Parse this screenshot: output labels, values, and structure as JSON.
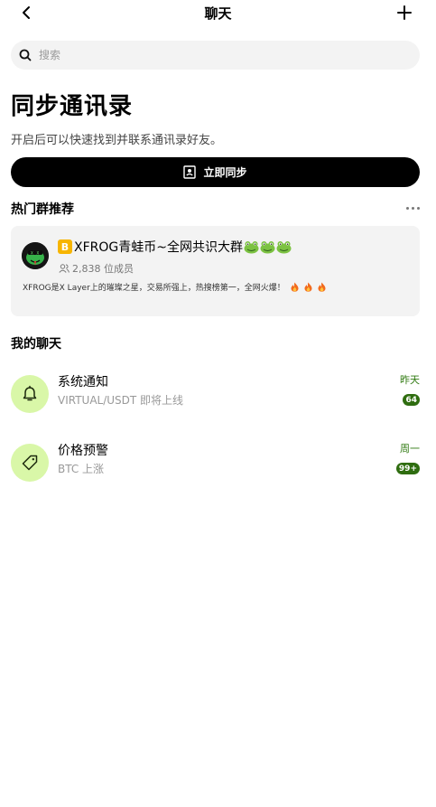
{
  "header": {
    "title": "聊天",
    "back_icon": "chevron-left-icon",
    "add_icon": "plus-icon"
  },
  "search": {
    "placeholder": "搜索",
    "icon": "search-icon"
  },
  "sync": {
    "title": "同步通讯录",
    "description": "开启后可以快速找到并联系通讯录好友。",
    "button_label": "立即同步",
    "button_icon": "contact-book-icon"
  },
  "hot_groups": {
    "title": "热门群推荐",
    "more_icon": "more-dots-icon",
    "group": {
      "badge": "B",
      "name": "XFROG青蛙币~全网共识大群",
      "members": "2,838 位成员",
      "description": "XFROG是X Layer上的璀璨之星，交易所强上，热搜榜第一，全网火爆！"
    }
  },
  "my_chats": {
    "title": "我的聊天",
    "items": [
      {
        "title": "系统通知",
        "subtitle": "VIRTUAL/USDT 即将上线",
        "time": "昨天",
        "badge": "64",
        "icon": "bell-icon"
      },
      {
        "title": "价格预警",
        "subtitle": "BTC 上涨",
        "time": "周一",
        "badge": "99+",
        "icon": "price-tag-icon"
      }
    ]
  },
  "colors": {
    "accent_green": "#2f7a10",
    "avatar_bg": "#d9f7a8",
    "card_bg": "#f3f3f3",
    "button_bg": "#000000"
  }
}
